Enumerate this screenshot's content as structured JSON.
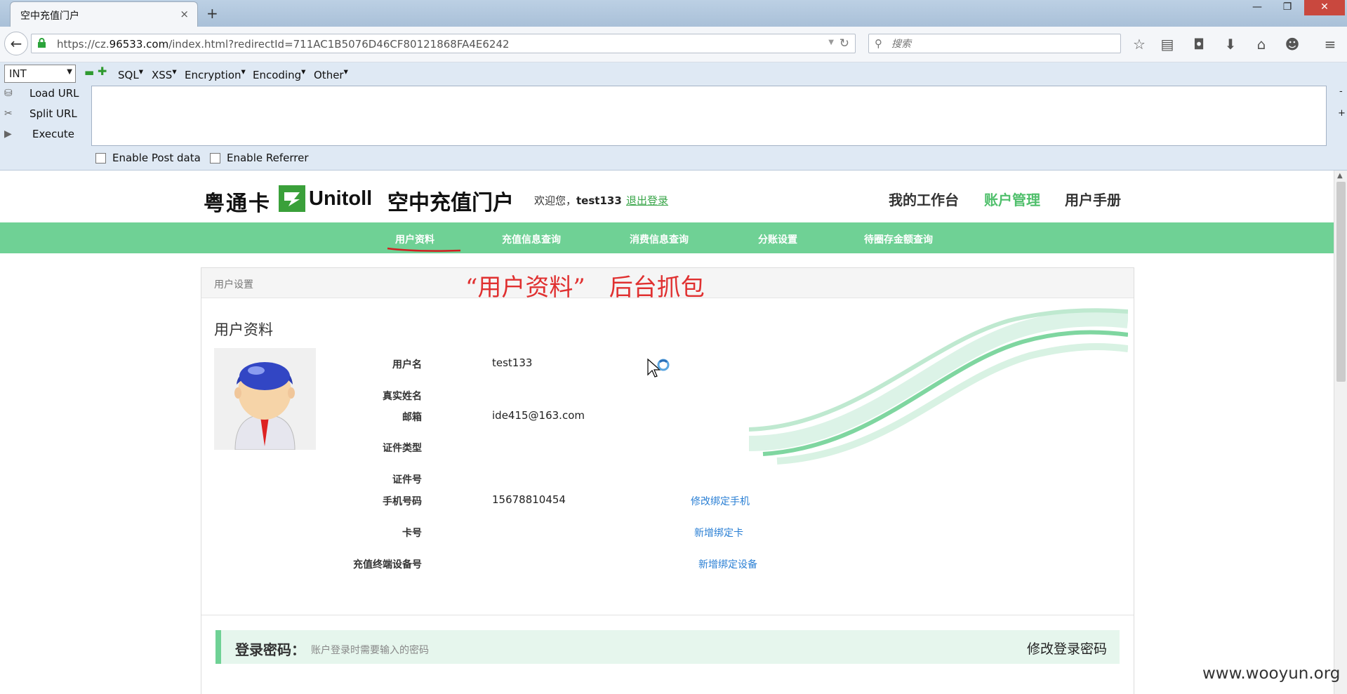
{
  "browser": {
    "tab_title": "空中充值门户",
    "tab_close": "×",
    "new_tab": "+",
    "win_min": "—",
    "win_max": "❐",
    "win_close": "✕",
    "back": "←",
    "url": "https://cz.96533.com/index.html?redirectId=711AC1B5076D46CF80121868FA4E6242",
    "url_domain_emphasis": "96533.com",
    "reload": "↻",
    "search_placeholder": "搜索",
    "toolbar_icons": [
      "star-icon",
      "reading-list-icon",
      "pocket-icon",
      "download-icon",
      "home-icon",
      "chat-icon",
      "menu-icon"
    ]
  },
  "hackbar": {
    "select_value": "INT",
    "menus": [
      "SQL",
      "XSS",
      "Encryption",
      "Encoding",
      "Other"
    ],
    "actions": [
      "Load URL",
      "Split URL",
      "Execute"
    ],
    "checkboxes": [
      "Enable Post data",
      "Enable Referrer"
    ],
    "textarea_value": "",
    "side_minus": "-",
    "side_plus": "+"
  },
  "site": {
    "logo_cn": "粤通卡",
    "logo_en": "Unitoll",
    "portal_name": "空中充值门户",
    "welcome_prefix": "欢迎您，",
    "username": "test133",
    "logout": "退出登录",
    "top_nav": [
      "我的工作台",
      "账户管理",
      "用户手册"
    ],
    "sub_nav": [
      "用户资料",
      "充值信息查询",
      "消费信息查询",
      "分账设置",
      "待圈存金额查询"
    ],
    "breadcrumb": "用户设置",
    "annotation": "“用户资料”　后台抓包",
    "section_title": "用户资料",
    "fields": [
      {
        "label": "用户名",
        "value": "test133",
        "link": ""
      },
      {
        "label": "真实姓名",
        "value": "",
        "link": ""
      },
      {
        "label": "邮箱",
        "value": "ide415@163.com",
        "link": ""
      },
      {
        "label": "证件类型",
        "value": "",
        "link": ""
      },
      {
        "label": "证件号",
        "value": "",
        "link": ""
      },
      {
        "label": "手机号码",
        "value": "15678810454",
        "link": "修改绑定手机"
      },
      {
        "label": "卡号",
        "value": "",
        "link": "新增绑定卡"
      },
      {
        "label": "充值终端设备号",
        "value": "",
        "link": "新增绑定设备"
      }
    ],
    "password": {
      "title": "登录密码：",
      "desc": "账户登录时需要输入的密码",
      "link": "修改登录密码"
    }
  },
  "watermark": "www.wooyun.org",
  "colors": {
    "brand_green": "#6fd195",
    "link_blue": "#2a7fd4",
    "annotation_red": "#e03030"
  }
}
